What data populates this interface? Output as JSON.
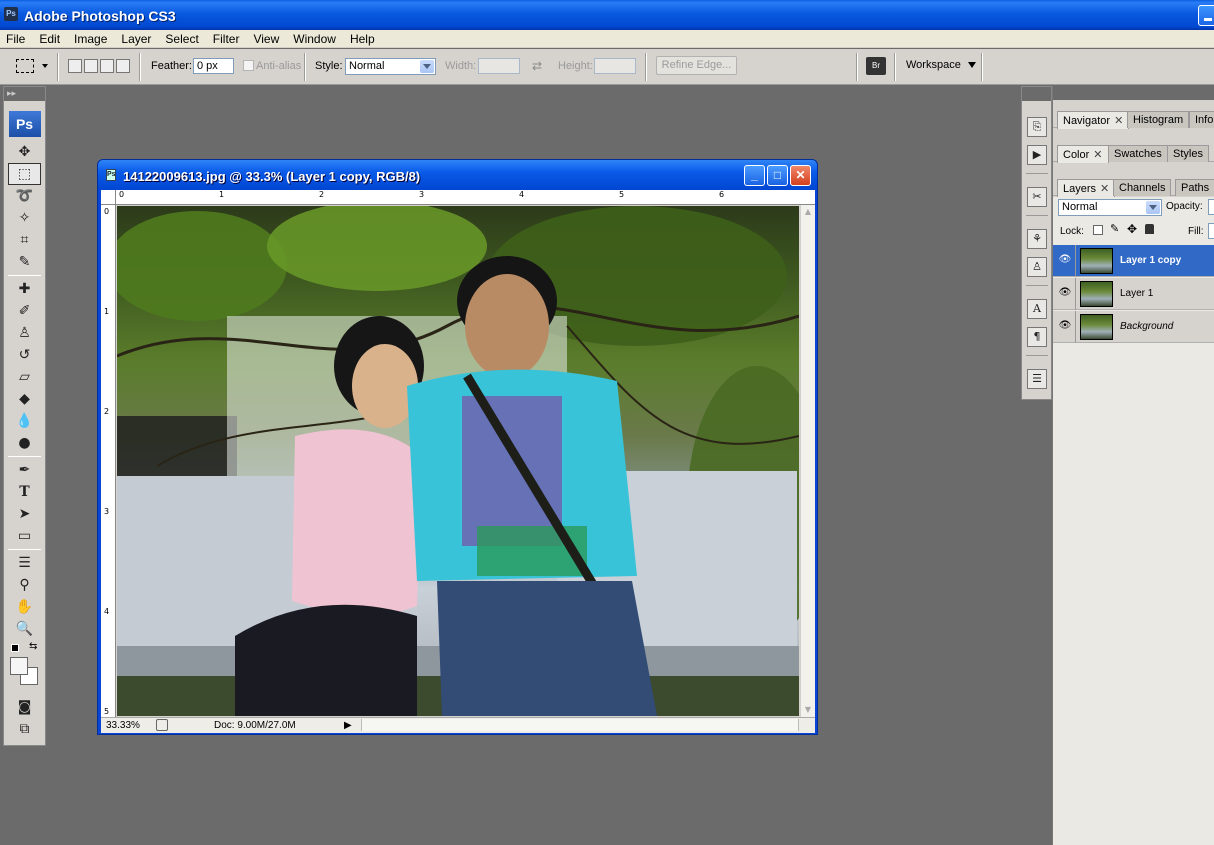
{
  "app": {
    "title": "Adobe Photoshop CS3",
    "icon_text": "Ps"
  },
  "menu": [
    "File",
    "Edit",
    "Image",
    "Layer",
    "Select",
    "Filter",
    "View",
    "Window",
    "Help"
  ],
  "options": {
    "feather_label": "Feather:",
    "feather_value": "0 px",
    "antialias_label": "Anti-alias",
    "style_label": "Style:",
    "style_value": "Normal",
    "width_label": "Width:",
    "height_label": "Height:",
    "refine_edge_label": "Refine Edge...",
    "workspace_label": "Workspace"
  },
  "toolbox": {
    "logo": "Ps"
  },
  "document": {
    "title": "14122009613.jpg @ 33.3% (Layer 1 copy, RGB/8)",
    "zoom": "33.33%",
    "doc_info": "Doc: 9.00M/27.0M",
    "ruler_h": [
      "0",
      "1",
      "2",
      "3",
      "4",
      "5",
      "6"
    ],
    "ruler_v": [
      "0",
      "1",
      "2",
      "3",
      "4",
      "5"
    ]
  },
  "panels": {
    "group1_tabs": [
      "Navigator",
      "Histogram",
      "Info"
    ],
    "group2_tabs": [
      "Color",
      "Swatches",
      "Styles"
    ],
    "group3_tabs": [
      "Layers",
      "Channels",
      "Paths"
    ],
    "blend_mode": "Normal",
    "opacity_label": "Opacity:",
    "lock_label": "Lock:",
    "fill_label": "Fill:",
    "layers": [
      {
        "name": "Layer 1 copy",
        "selected": true,
        "italic": false
      },
      {
        "name": "Layer 1",
        "selected": false,
        "italic": false
      },
      {
        "name": "Background",
        "selected": false,
        "italic": true
      }
    ]
  },
  "colors": {
    "xp_blue": "#0a5ae0",
    "close_red": "#d4401e",
    "selection_blue": "#3169c6",
    "workspace_gray": "#6b6b6b"
  }
}
